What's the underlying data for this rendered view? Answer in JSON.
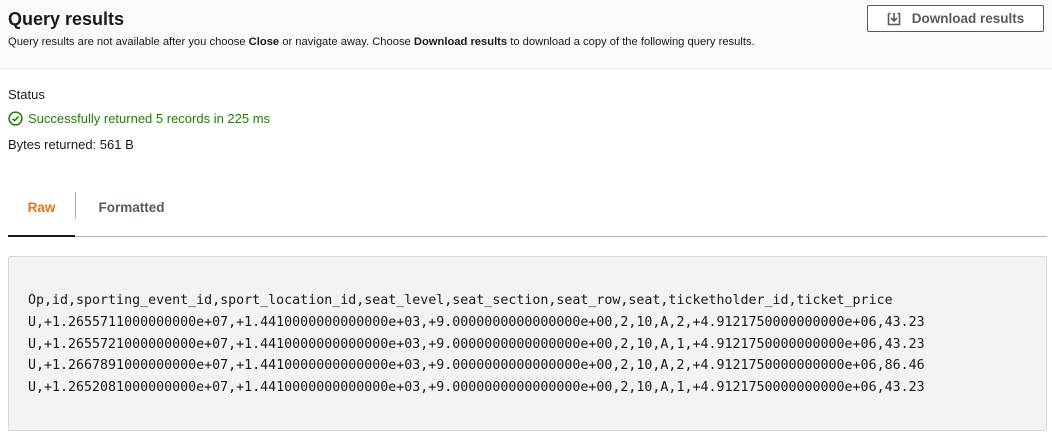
{
  "header": {
    "title": "Query results",
    "description": {
      "part1": "Query results are not available after you choose ",
      "bold1": "Close",
      "part2": " or navigate away. Choose ",
      "bold2": "Download results",
      "part3": " to download a copy of the following query results."
    },
    "download_label": "Download results"
  },
  "status": {
    "label": "Status",
    "message": "Successfully returned 5 records in 225 ms",
    "bytes": "Bytes returned: 561 B",
    "success_color": "#1d8102"
  },
  "tabs": [
    {
      "label": "Raw",
      "active": true
    },
    {
      "label": "Formatted",
      "active": false
    }
  ],
  "results": {
    "lines": [
      "Op,id,sporting_event_id,sport_location_id,seat_level,seat_section,seat_row,seat,ticketholder_id,ticket_price",
      "U,+1.2655711000000000e+07,+1.4410000000000000e+03,+9.0000000000000000e+00,2,10,A,2,+4.9121750000000000e+06,43.23",
      "U,+1.2655721000000000e+07,+1.4410000000000000e+03,+9.0000000000000000e+00,2,10,A,1,+4.9121750000000000e+06,43.23",
      "U,+1.2667891000000000e+07,+1.4410000000000000e+03,+9.0000000000000000e+00,2,10,A,2,+4.9121750000000000e+06,86.46",
      "U,+1.2652081000000000e+07,+1.4410000000000000e+03,+9.0000000000000000e+00,2,10,A,1,+4.9121750000000000e+06,43.23"
    ]
  },
  "colors": {
    "active_tab": "#ec7211",
    "inactive_tab": "#545b64",
    "code_background": "#f2f3f3"
  },
  "icons": {
    "download": "download-icon",
    "success": "check-circle-icon"
  }
}
